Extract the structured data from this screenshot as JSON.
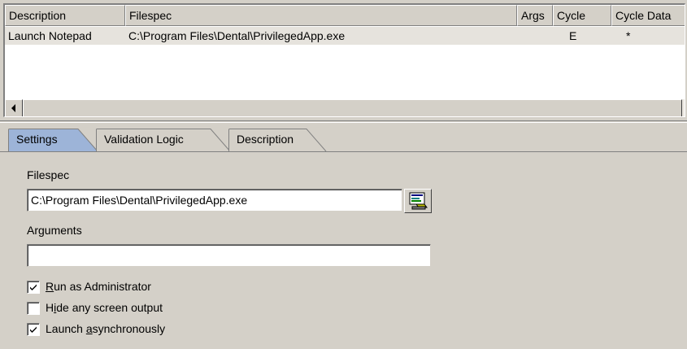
{
  "list": {
    "columns": [
      "Description",
      "Filespec",
      "Args",
      "Cycle",
      "Cycle Data"
    ],
    "rows": [
      {
        "description": "Launch Notepad",
        "filespec": "C:\\Program Files\\Dental\\PrivilegedApp.exe",
        "args": "",
        "cycle": "E",
        "cycle_data": "*"
      }
    ]
  },
  "tabs": [
    {
      "label": "Settings",
      "active": true
    },
    {
      "label": "Validation Logic",
      "active": false
    },
    {
      "label": "Description",
      "active": false
    }
  ],
  "settings": {
    "filespec_label": "Filespec",
    "filespec_value": "C:\\Program Files\\Dental\\PrivilegedApp.exe",
    "arguments_label": "Arguments",
    "arguments_value": "",
    "options": [
      {
        "pre": "",
        "key": "R",
        "post": "un as Administrator",
        "checked": true
      },
      {
        "pre": "H",
        "key": "i",
        "post": "de any screen output",
        "checked": false
      },
      {
        "pre": "Launch ",
        "key": "a",
        "post": "synchronously",
        "checked": true
      }
    ]
  },
  "icons": {
    "browse": "browse-folder-icon",
    "scroll_left": "arrow-left-icon",
    "check": "check-icon"
  }
}
